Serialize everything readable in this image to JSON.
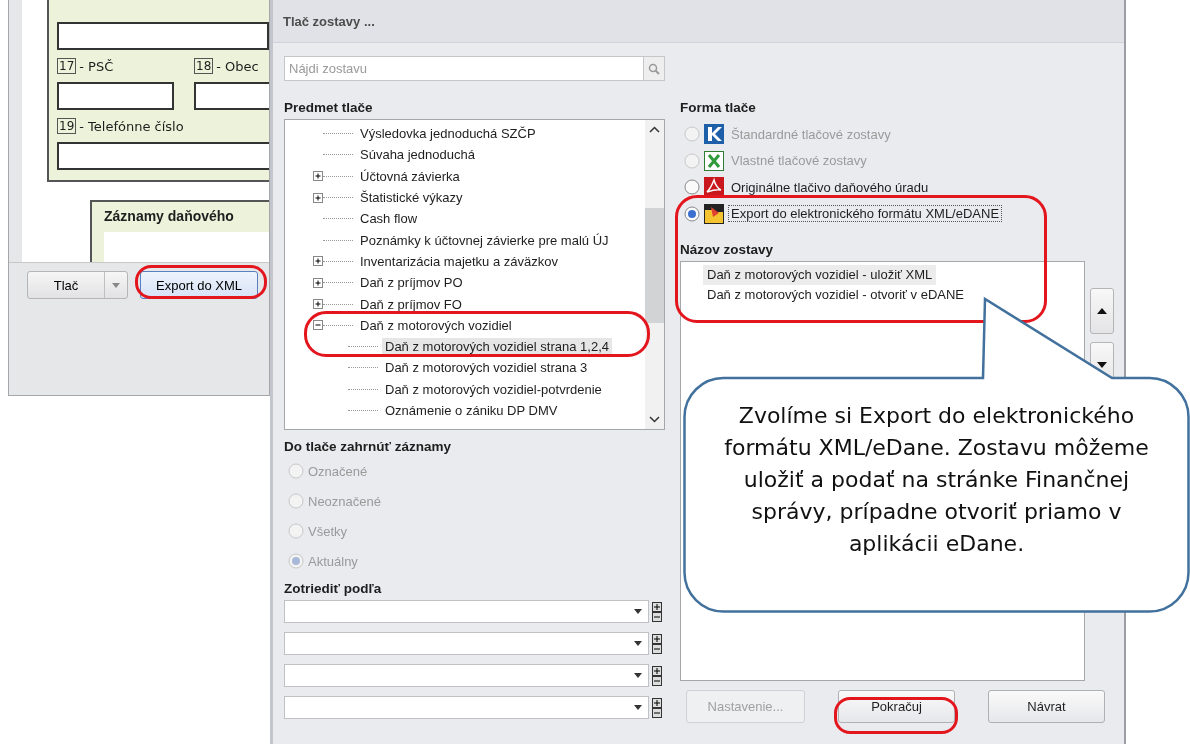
{
  "background_window": {
    "fields": [
      {
        "number": "17",
        "label": "- PSČ"
      },
      {
        "number": "18",
        "label": "- Obec"
      },
      {
        "number": "19",
        "label": "- Telefónne číslo"
      }
    ],
    "section_title": "Záznamy daňového",
    "print_button": "Tlač",
    "export_button": "Export do XML"
  },
  "dialog": {
    "title": "Tlač zostavy ...",
    "search": {
      "placeholder": "Nájdi zostavu"
    },
    "tree": {
      "title": "Predmet tlače",
      "items": [
        {
          "label": "Výsledovka jednoduchá SZČP",
          "kind": "report",
          "selected": false
        },
        {
          "label": "Súvaha jednoduchá",
          "kind": "report",
          "selected": false
        },
        {
          "label": "Účtovná závierka",
          "kind": "folder",
          "expanded": false,
          "selected": false
        },
        {
          "label": "Štatistické výkazy",
          "kind": "folder",
          "expanded": false,
          "selected": false
        },
        {
          "label": "Cash flow",
          "kind": "report",
          "selected": false
        },
        {
          "label": "Poznámky k účtovnej závierke pre malú ÚJ",
          "kind": "report",
          "selected": false
        },
        {
          "label": "Inventarizácia majetku a záväzkov",
          "kind": "folder",
          "expanded": false,
          "selected": false
        },
        {
          "label": "Daň z príjmov PO",
          "kind": "folder",
          "expanded": false,
          "selected": false
        },
        {
          "label": "Daň z príjmov FO",
          "kind": "folder",
          "expanded": false,
          "selected": false
        },
        {
          "label": "Daň z motorových vozidiel",
          "kind": "folder",
          "expanded": true,
          "selected": false,
          "children": [
            {
              "label": "Daň z motorových vozidiel strana 1,2,4",
              "kind": "report",
              "selected": true
            },
            {
              "label": "Daň z motorových vozidiel strana 3",
              "kind": "report",
              "selected": false
            },
            {
              "label": "Daň z motorových vozidiel-potvrdenie",
              "kind": "report",
              "selected": false
            },
            {
              "label": "Oznámenie o zániku DP DMV",
              "kind": "report",
              "selected": false
            }
          ]
        }
      ]
    },
    "records": {
      "title": "Do tlače zahrnúť záznamy",
      "options": [
        {
          "label": "Označené",
          "selected": false,
          "disabled": true
        },
        {
          "label": "Neoznačené",
          "selected": false,
          "disabled": true
        },
        {
          "label": "Všetky",
          "selected": false,
          "disabled": true
        },
        {
          "label": "Aktuálny",
          "selected": true,
          "disabled": true
        }
      ]
    },
    "sort": {
      "title": "Zotriediť podľa"
    },
    "print_form": {
      "title": "Forma tlače",
      "options": [
        {
          "label": "Štandardné tlačové zostavy",
          "kind": "kros",
          "selected": false,
          "disabled": true
        },
        {
          "label": "Vlastné tlačové zostavy",
          "kind": "sheet",
          "selected": false,
          "disabled": true
        },
        {
          "label": "Originálne tlačivo daňového úradu",
          "kind": "pdf",
          "selected": false,
          "disabled": false
        },
        {
          "label": "Export do elektronického formátu XML/eDANE",
          "kind": "export",
          "selected": true,
          "disabled": false
        }
      ]
    },
    "report_names": {
      "title": "Názov zostavy",
      "items": [
        {
          "label": "Daň z motorových vozidiel - uložiť XML",
          "selected": true
        },
        {
          "label": "Daň z motorových vozidiel - otvoriť v eDANE",
          "selected": false
        }
      ]
    },
    "buttons": [
      {
        "label": "Nastavenie...",
        "disabled": true
      },
      {
        "label": "Pokračuj",
        "disabled": false
      },
      {
        "label": "Návrat",
        "disabled": false
      }
    ]
  },
  "callout": {
    "text": "Zvolíme si Export do elektronického formátu XML/eDane. Zostavu môžeme uložiť a podať na stránke Finančnej správy, prípadne otvoriť priamo v aplikácii eDane."
  }
}
